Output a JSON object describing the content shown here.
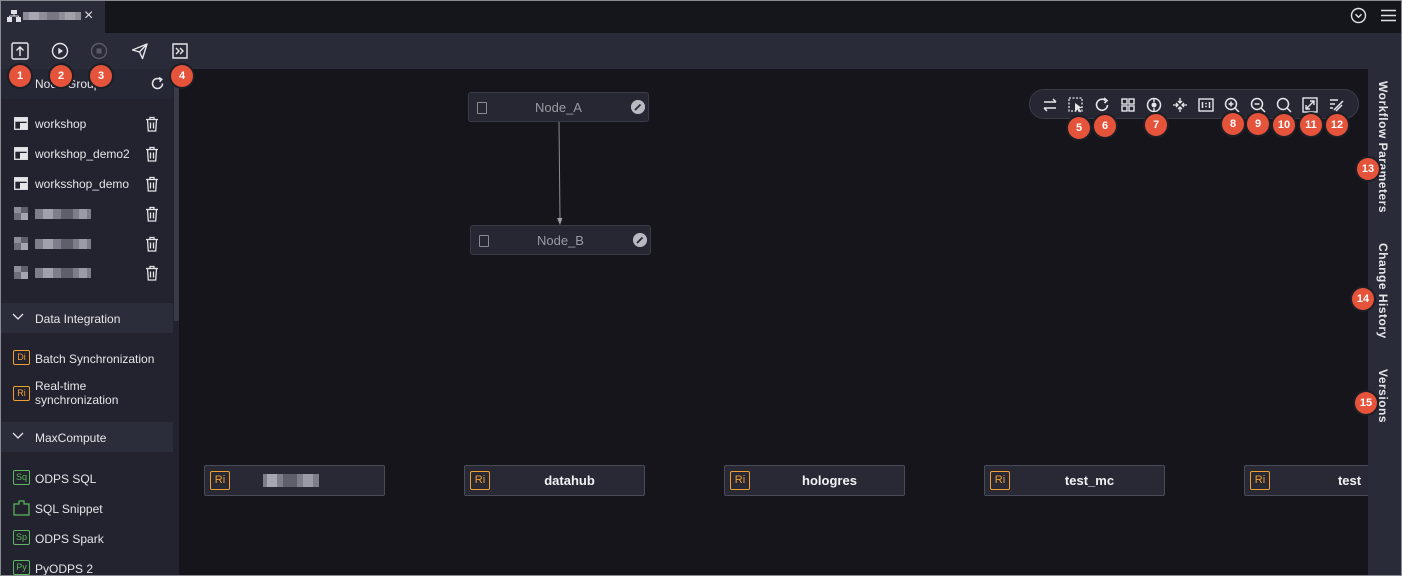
{
  "tab": {
    "title": "",
    "close": "×"
  },
  "node_group": {
    "title": "Node Group"
  },
  "node_group_items": [
    {
      "label": "workshop"
    },
    {
      "label": "workshop_demo2"
    },
    {
      "label": "worksshop_demo"
    },
    {
      "label": ""
    },
    {
      "label": ""
    },
    {
      "label": ""
    }
  ],
  "categories": {
    "data_integration": "Data Integration",
    "maxcompute": "MaxCompute"
  },
  "data_integration_items": [
    {
      "badge": "Di",
      "label": "Batch Synchronization"
    },
    {
      "badge": "Ri",
      "label": "Real-time synchronization"
    }
  ],
  "maxcompute_items": [
    {
      "badge": "Sq",
      "label": "ODPS SQL"
    },
    {
      "badge": "",
      "label": "SQL Snippet"
    },
    {
      "badge": "Sp",
      "label": "ODPS Spark"
    },
    {
      "badge": "Py",
      "label": "PyODPS 2"
    }
  ],
  "canvas_nodes": [
    {
      "label": "Node_A"
    },
    {
      "label": "Node_B"
    }
  ],
  "realtime_nodes": [
    {
      "badge": "Ri",
      "label": ""
    },
    {
      "badge": "Ri",
      "label": "datahub"
    },
    {
      "badge": "Ri",
      "label": "hologres"
    },
    {
      "badge": "Ri",
      "label": "test_mc"
    },
    {
      "badge": "Ri",
      "label": "test"
    }
  ],
  "right_rail": {
    "workflow_parameters": "Workflow Parameters",
    "change_history": "Change History",
    "versions": "Versions"
  },
  "markers": [
    "1",
    "2",
    "3",
    "4",
    "5",
    "6",
    "7",
    "8",
    "9",
    "10",
    "11",
    "12",
    "13",
    "14",
    "15"
  ],
  "colors": {
    "marker": "#e5533a",
    "realtime_badge": "#f0a032",
    "di_badge": "#f0a032",
    "maxcompute_badge": "#5cb85c",
    "canvas_bg": "#15151b",
    "panel_bg": "#22232e"
  },
  "icons": {
    "toolbar": [
      "submit-icon",
      "run-icon",
      "stop-icon",
      "publish-icon",
      "goto-ops-icon"
    ],
    "graph_tools": [
      "switch-icon",
      "box-select-icon",
      "refresh-icon",
      "format-icon",
      "center-icon",
      "fit-icon",
      "one-to-one-icon",
      "zoom-in-icon",
      "zoom-out-icon",
      "search-icon",
      "fullscreen-icon",
      "toggle-engine-icon"
    ]
  }
}
